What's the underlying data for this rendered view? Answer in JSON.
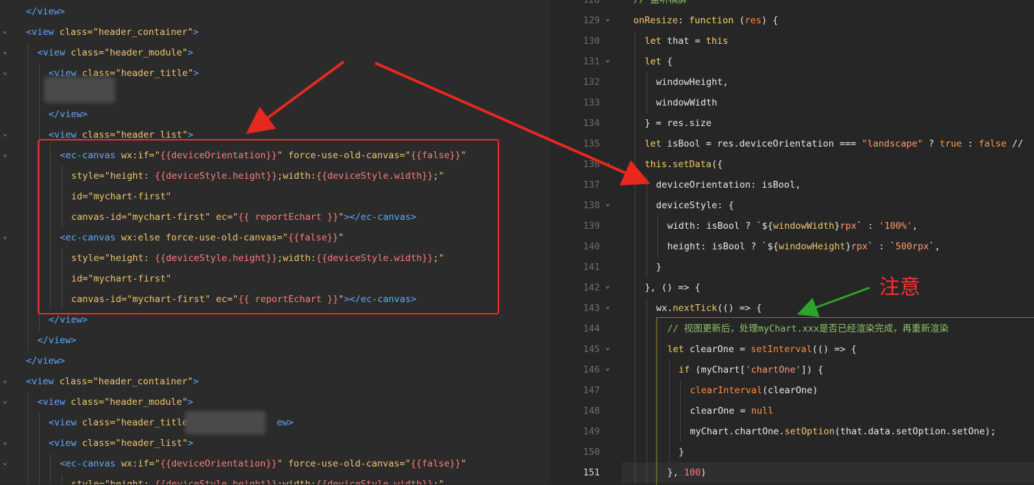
{
  "left": {
    "lines": [
      {
        "indent": 1,
        "segs": [
          [
            "tag",
            "</view>"
          ]
        ]
      },
      {
        "indent": 1,
        "segs": [
          [
            "tag",
            "<view "
          ],
          [
            "attr",
            "class="
          ],
          [
            "str",
            "\"header_container\""
          ],
          [
            "tag",
            ">"
          ]
        ]
      },
      {
        "indent": 2,
        "segs": [
          [
            "tag",
            "<view "
          ],
          [
            "attr",
            "class="
          ],
          [
            "str",
            "\"header_module\""
          ],
          [
            "tag",
            ">"
          ]
        ]
      },
      {
        "indent": 3,
        "segs": [
          [
            "tag",
            "<view "
          ],
          [
            "attr",
            "class="
          ],
          [
            "str",
            "\"header_title\""
          ],
          [
            "tag",
            ">"
          ]
        ]
      },
      {
        "indent": 3,
        "segs": []
      },
      {
        "indent": 3,
        "segs": [
          [
            "tag",
            "</view>"
          ]
        ]
      },
      {
        "indent": 3,
        "segs": [
          [
            "tag",
            "<view "
          ],
          [
            "attr",
            "class="
          ],
          [
            "str",
            "\"header_list\""
          ],
          [
            "tag",
            ">"
          ]
        ]
      },
      {
        "indent": 4,
        "segs": [
          [
            "tag",
            "<ec-canvas "
          ],
          [
            "attr",
            "wx:if="
          ],
          [
            "str",
            "\""
          ],
          [
            "tpl",
            "{{deviceOrientation}}"
          ],
          [
            "str",
            "\""
          ],
          [
            "attr",
            " force-use-old-canvas="
          ],
          [
            "str",
            "\""
          ],
          [
            "tpl",
            "{{false}}"
          ],
          [
            "str",
            "\""
          ]
        ]
      },
      {
        "indent": 5,
        "segs": [
          [
            "attr",
            "style="
          ],
          [
            "str",
            "\"height: "
          ],
          [
            "tpl",
            "{{deviceStyle.height}}"
          ],
          [
            "str",
            ";width:"
          ],
          [
            "tpl",
            "{{deviceStyle.width}}"
          ],
          [
            "str",
            ";\""
          ]
        ]
      },
      {
        "indent": 5,
        "segs": [
          [
            "attr",
            "id="
          ],
          [
            "str",
            "\"mychart-first\""
          ]
        ]
      },
      {
        "indent": 5,
        "segs": [
          [
            "attr",
            "canvas-id="
          ],
          [
            "str",
            "\"mychart-first\""
          ],
          [
            "attr",
            " ec="
          ],
          [
            "str",
            "\""
          ],
          [
            "tpl",
            "{{ reportEchart }}"
          ],
          [
            "str",
            "\""
          ],
          [
            "tag",
            ">"
          ],
          [
            "tag",
            "</ec-canvas>"
          ]
        ]
      },
      {
        "indent": 4,
        "segs": [
          [
            "tag",
            "<ec-canvas "
          ],
          [
            "attr",
            "wx:else force-use-old-canvas="
          ],
          [
            "str",
            "\""
          ],
          [
            "tpl",
            "{{false}}"
          ],
          [
            "str",
            "\""
          ]
        ]
      },
      {
        "indent": 5,
        "segs": [
          [
            "attr",
            "style="
          ],
          [
            "str",
            "\"height: "
          ],
          [
            "tpl",
            "{{deviceStyle.height}}"
          ],
          [
            "str",
            ";width:"
          ],
          [
            "tpl",
            "{{deviceStyle.width}}"
          ],
          [
            "str",
            ";\""
          ]
        ]
      },
      {
        "indent": 5,
        "segs": [
          [
            "attr",
            "id="
          ],
          [
            "str",
            "\"mychart-first\""
          ]
        ]
      },
      {
        "indent": 5,
        "segs": [
          [
            "attr",
            "canvas-id="
          ],
          [
            "str",
            "\"mychart-first\""
          ],
          [
            "attr",
            " ec="
          ],
          [
            "str",
            "\""
          ],
          [
            "tpl",
            "{{ reportEchart }}"
          ],
          [
            "str",
            "\""
          ],
          [
            "tag",
            ">"
          ],
          [
            "tag",
            "</ec-canvas>"
          ]
        ]
      },
      {
        "indent": 3,
        "segs": [
          [
            "tag",
            "</view>"
          ]
        ]
      },
      {
        "indent": 2,
        "segs": [
          [
            "tag",
            "</view>"
          ]
        ]
      },
      {
        "indent": 1,
        "segs": [
          [
            "tag",
            "</view>"
          ]
        ]
      },
      {
        "indent": 1,
        "segs": [
          [
            "tag",
            "<view "
          ],
          [
            "attr",
            "class="
          ],
          [
            "str",
            "\"header_container\""
          ],
          [
            "tag",
            ">"
          ]
        ]
      },
      {
        "indent": 2,
        "segs": [
          [
            "tag",
            "<view "
          ],
          [
            "attr",
            "class="
          ],
          [
            "str",
            "\"header_module\""
          ],
          [
            "tag",
            ">"
          ]
        ]
      },
      {
        "indent": 3,
        "segs": [
          [
            "tag",
            "<view "
          ],
          [
            "attr",
            "class="
          ],
          [
            "str",
            "\"header_title"
          ],
          [
            "ec",
            "                "
          ],
          [
            "tag",
            "ew>"
          ]
        ]
      },
      {
        "indent": 3,
        "segs": [
          [
            "tag",
            "<view "
          ],
          [
            "attr",
            "class="
          ],
          [
            "str",
            "\"header_list\""
          ],
          [
            "tag",
            ">"
          ]
        ]
      },
      {
        "indent": 4,
        "segs": [
          [
            "tag",
            "<ec-canvas "
          ],
          [
            "attr",
            "wx:if="
          ],
          [
            "str",
            "\""
          ],
          [
            "tpl",
            "{{deviceOrientation}}"
          ],
          [
            "str",
            "\""
          ],
          [
            "attr",
            " force-use-old-canvas="
          ],
          [
            "str",
            "\""
          ],
          [
            "tpl",
            "{{false}}"
          ],
          [
            "str",
            "\""
          ]
        ]
      },
      {
        "indent": 5,
        "segs": [
          [
            "attr",
            "style="
          ],
          [
            "str",
            "\"height: "
          ],
          [
            "tpl",
            "{{deviceStyle.height}}"
          ],
          [
            "str",
            ";width:"
          ],
          [
            "tpl",
            "{{deviceStyle.width}}"
          ],
          [
            "str",
            ";\""
          ]
        ]
      }
    ]
  },
  "right": {
    "lines": [
      {
        "num": "128",
        "indent": 1,
        "segs": [
          [
            "cmt",
            "// 监听横屏"
          ]
        ]
      },
      {
        "num": "129",
        "indent": 1,
        "segs": [
          [
            "fn",
            "onResize"
          ],
          [
            "prop",
            ": "
          ],
          [
            "kw",
            "function "
          ],
          [
            "prop",
            "("
          ],
          [
            "call",
            "res"
          ],
          [
            "prop",
            ") {"
          ]
        ]
      },
      {
        "num": "130",
        "indent": 2,
        "segs": [
          [
            "kw",
            "let "
          ],
          [
            "prop",
            "that = "
          ],
          [
            "kw",
            "this"
          ]
        ]
      },
      {
        "num": "131",
        "indent": 2,
        "segs": [
          [
            "kw",
            "let "
          ],
          [
            "prop",
            "{"
          ]
        ]
      },
      {
        "num": "132",
        "indent": 3,
        "segs": [
          [
            "prop",
            "windowHeight,"
          ]
        ]
      },
      {
        "num": "133",
        "indent": 3,
        "segs": [
          [
            "prop",
            "windowWidth"
          ]
        ]
      },
      {
        "num": "134",
        "indent": 2,
        "segs": [
          [
            "prop",
            "} = res.size"
          ]
        ]
      },
      {
        "num": "135",
        "indent": 2,
        "segs": [
          [
            "kw",
            "let "
          ],
          [
            "prop",
            "isBool = res.deviceOrientation === "
          ],
          [
            "s",
            "\"landscape\""
          ],
          [
            "prop",
            " ? "
          ],
          [
            "bool",
            "true"
          ],
          [
            "prop",
            " : "
          ],
          [
            "bool",
            "false"
          ],
          [
            "prop",
            " //"
          ]
        ]
      },
      {
        "num": "136",
        "indent": 2,
        "segs": [
          [
            "kw",
            "this"
          ],
          [
            "prop",
            "."
          ],
          [
            "fn",
            "setData"
          ],
          [
            "prop",
            "({"
          ]
        ]
      },
      {
        "num": "137",
        "indent": 3,
        "segs": [
          [
            "prop",
            "deviceOrientation: isBool,"
          ]
        ]
      },
      {
        "num": "138",
        "indent": 3,
        "segs": [
          [
            "prop",
            "deviceStyle: {"
          ]
        ]
      },
      {
        "num": "139",
        "indent": 4,
        "segs": [
          [
            "prop",
            "width: isBool ? `${"
          ],
          [
            "fn",
            "windowWidth"
          ],
          [
            "prop",
            "}"
          ],
          [
            "s",
            "rpx"
          ],
          [
            "prop",
            "` : "
          ],
          [
            "s",
            "'100%'"
          ],
          [
            "prop",
            ","
          ]
        ]
      },
      {
        "num": "140",
        "indent": 4,
        "segs": [
          [
            "prop",
            "height: isBool ? `${"
          ],
          [
            "fn",
            "windowHeight"
          ],
          [
            "prop",
            "}"
          ],
          [
            "s",
            "rpx"
          ],
          [
            "prop",
            "` : `"
          ],
          [
            "s",
            "500rpx"
          ],
          [
            "prop",
            "`,"
          ]
        ]
      },
      {
        "num": "141",
        "indent": 3,
        "segs": [
          [
            "prop",
            "}"
          ]
        ]
      },
      {
        "num": "142",
        "indent": 2,
        "segs": [
          [
            "prop",
            "}, () => {"
          ]
        ]
      },
      {
        "num": "143",
        "indent": 3,
        "segs": [
          [
            "prop",
            "wx."
          ],
          [
            "fn",
            "nextTick"
          ],
          [
            "prop",
            "(() => {"
          ]
        ]
      },
      {
        "num": "144",
        "indent": 4,
        "segs": [
          [
            "cmt",
            "// 视图更新后，处理myChart.xxx是否已经渲染完成，再重新渲染"
          ]
        ]
      },
      {
        "num": "145",
        "indent": 4,
        "segs": [
          [
            "kw",
            "let "
          ],
          [
            "prop",
            "clearOne = "
          ],
          [
            "call",
            "setInterval"
          ],
          [
            "prop",
            "(() => {"
          ]
        ]
      },
      {
        "num": "146",
        "indent": 5,
        "segs": [
          [
            "kw",
            "if "
          ],
          [
            "prop",
            "(myChart["
          ],
          [
            "s",
            "'chartOne'"
          ],
          [
            "prop",
            "]) {"
          ]
        ]
      },
      {
        "num": "147",
        "indent": 6,
        "segs": [
          [
            "call",
            "clearInterval"
          ],
          [
            "prop",
            "(clearOne)"
          ]
        ]
      },
      {
        "num": "148",
        "indent": 6,
        "segs": [
          [
            "prop",
            "clearOne = "
          ],
          [
            "bool",
            "null"
          ]
        ]
      },
      {
        "num": "149",
        "indent": 6,
        "segs": [
          [
            "prop",
            "myChart.chartOne."
          ],
          [
            "fn",
            "setOption"
          ],
          [
            "prop",
            "(that.data.setOption.setOne);"
          ]
        ]
      },
      {
        "num": "150",
        "indent": 5,
        "segs": [
          [
            "prop",
            "}"
          ]
        ]
      },
      {
        "num": "151",
        "indent": 4,
        "segs": [
          [
            "prop",
            "}, "
          ],
          [
            "num",
            "100"
          ],
          [
            "prop",
            ")"
          ]
        ]
      }
    ]
  },
  "annotation": {
    "note": "注意"
  },
  "colors": {
    "highlight_box": "#e53232",
    "red_arrow": "#e8281e",
    "green_arrow": "#2aa52a"
  }
}
